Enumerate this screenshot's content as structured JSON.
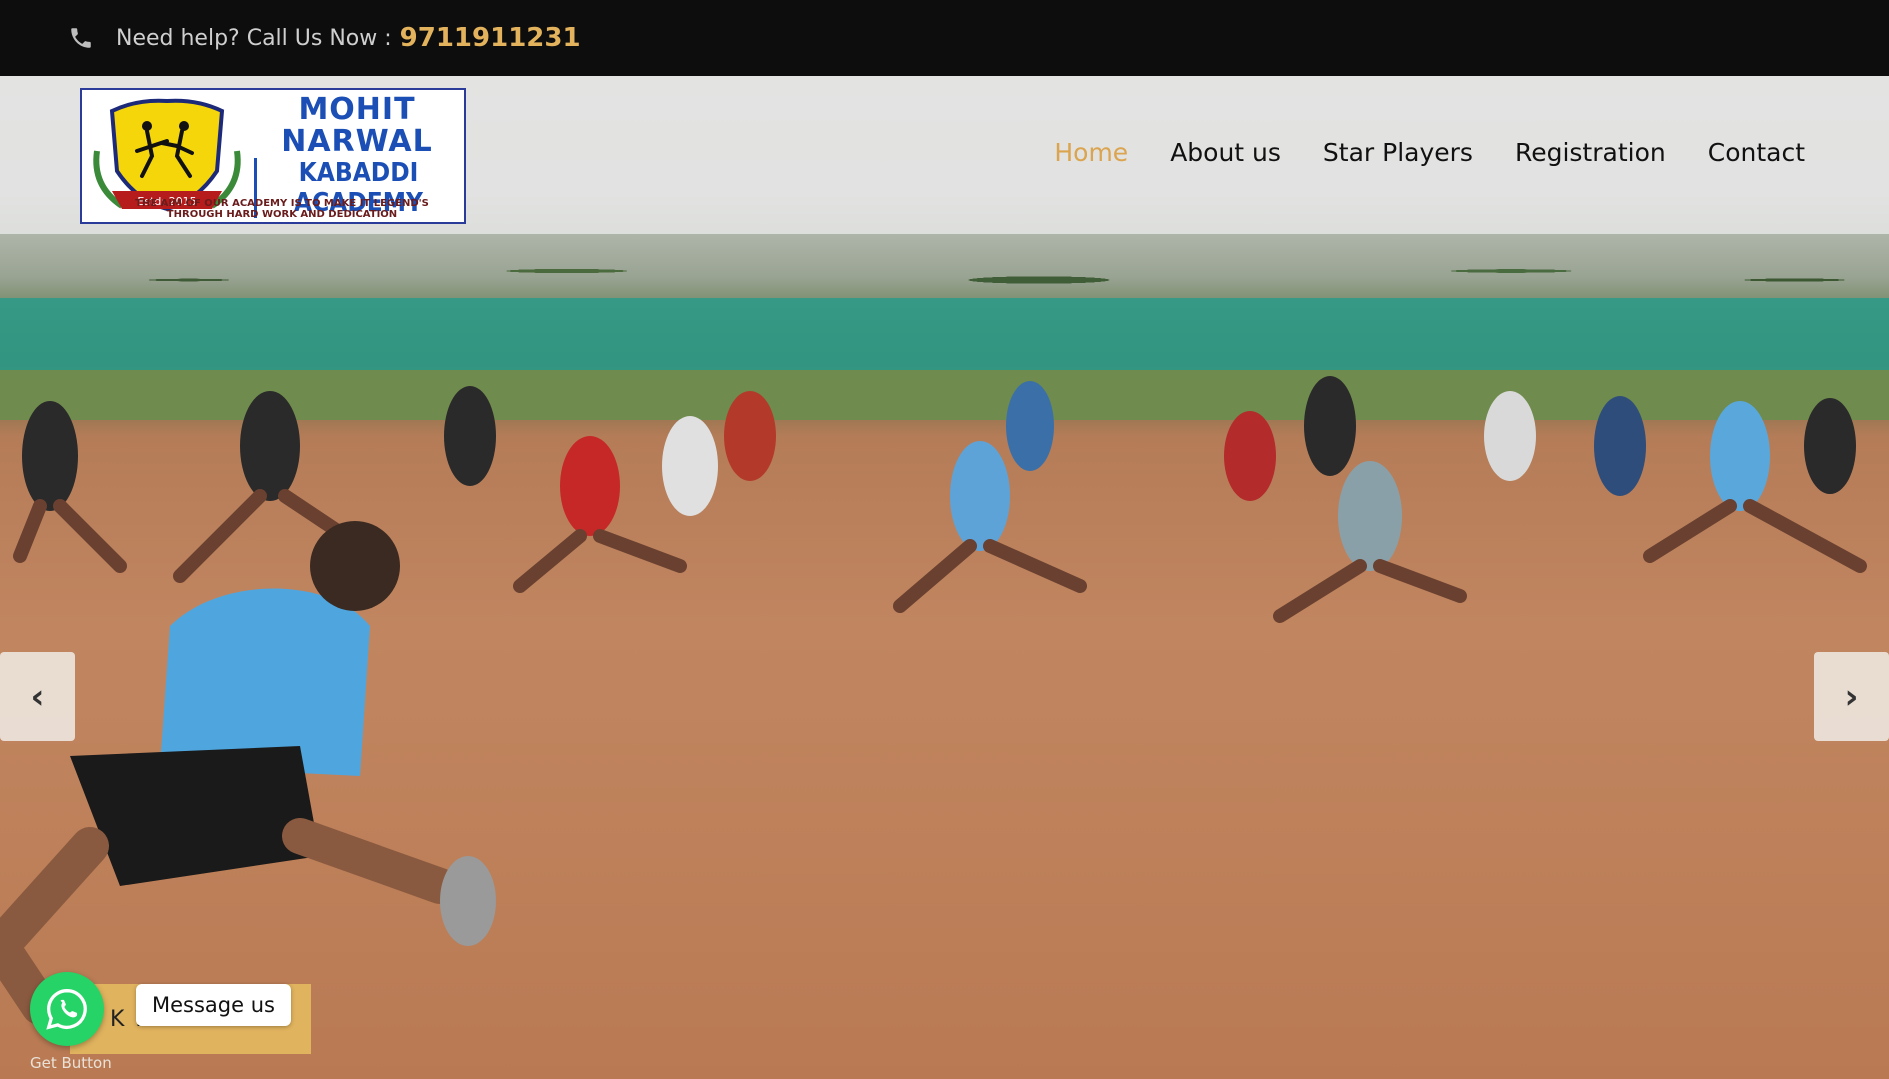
{
  "topbar": {
    "help_text": "Need help? Call Us Now :",
    "phone_number": "9711911231",
    "number_color": "#e3b25c"
  },
  "logo": {
    "line1": "MOHIT",
    "line2": "NARWAL",
    "line3": "KABADDI ACADEMY",
    "established": "Estd: 2015",
    "tagline": "THE AIM OF OUR ACADEMY IS TO MAKE IT LEGEND'S THROUGH HARD WORK AND DEDICATION"
  },
  "nav": {
    "items": [
      {
        "label": "Home",
        "active": true
      },
      {
        "label": "About us",
        "active": false
      },
      {
        "label": "Star Players",
        "active": false
      },
      {
        "label": "Registration",
        "active": false
      },
      {
        "label": "Contact",
        "active": false
      }
    ],
    "active_color": "#dba44f"
  },
  "slider": {
    "prev_icon": "chevron-left-icon",
    "next_icon": "chevron-right-icon"
  },
  "cta": {
    "label": "K N"
  },
  "whatsapp": {
    "tooltip": "Message us",
    "footer": "Get Button",
    "color": "#25d366"
  }
}
